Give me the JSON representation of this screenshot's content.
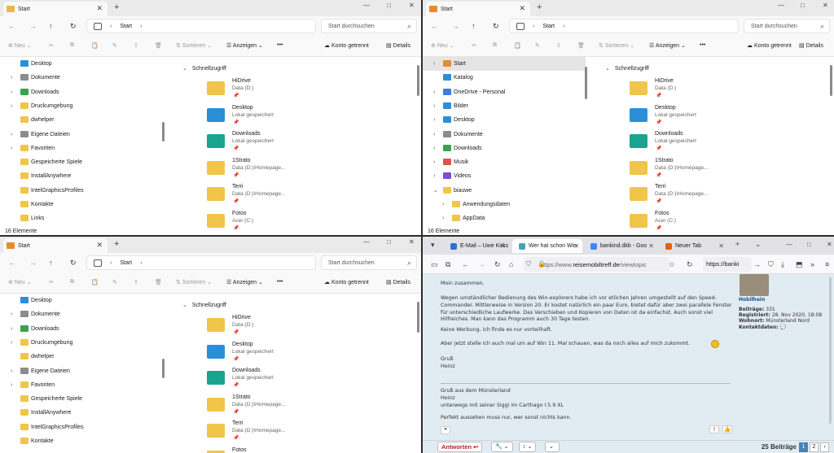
{
  "explorer": {
    "tab_title": "Start",
    "new_tab": "+",
    "minimize": "—",
    "maximize": "□",
    "close": "✕",
    "address": "Start",
    "search_placeholder": "Start durchsuchen",
    "toolbar": {
      "new": "Neu",
      "sort": "Sortieren",
      "view": "Anzeigen",
      "more": "•••",
      "account": "Konto getrennt",
      "details": "Details"
    },
    "sidebar_items": [
      {
        "label": "Desktop",
        "icon": "desktop-folder-icon",
        "color": "#2b8fd8",
        "chev": false
      },
      {
        "label": "Dokumente",
        "icon": "documents-folder-icon",
        "color": "#8c8c8c",
        "chev": true
      },
      {
        "label": "Downloads",
        "icon": "downloads-folder-icon",
        "color": "#3aa34a",
        "chev": true
      },
      {
        "label": "Druckumgebung",
        "icon": "folder-icon",
        "color": "#f0c54a",
        "chev": true
      },
      {
        "label": "dwhelper",
        "icon": "folder-icon",
        "color": "#f0c54a",
        "chev": false
      },
      {
        "label": "Eigene Dateien",
        "icon": "documents-folder-icon",
        "color": "#8c8c8c",
        "chev": true
      },
      {
        "label": "Favoriten",
        "icon": "star-folder-icon",
        "color": "#f0c54a",
        "chev": true
      },
      {
        "label": "Gespeicherte Spiele",
        "icon": "folder-icon",
        "color": "#f0c54a",
        "chev": false
      },
      {
        "label": "InstallAnywhere",
        "icon": "folder-icon",
        "color": "#f0c54a",
        "chev": false
      },
      {
        "label": "IntelGraphicsProfiles",
        "icon": "folder-icon",
        "color": "#f0c54a",
        "chev": false
      },
      {
        "label": "Kontakte",
        "icon": "folder-icon",
        "color": "#f0c54a",
        "chev": false
      },
      {
        "label": "Links",
        "icon": "folder-icon",
        "color": "#f0c54a",
        "chev": false
      }
    ],
    "sidebar_items_right": [
      {
        "label": "Start",
        "icon": "home-icon",
        "color": "#e98a2e",
        "chev": true,
        "selected": true
      },
      {
        "label": "Katalog",
        "icon": "gallery-icon",
        "color": "#2b8fd8",
        "chev": false
      },
      {
        "label": "OneDrive - Personal",
        "icon": "cloud-icon",
        "color": "#3b7de0",
        "chev": true
      },
      {
        "label": "Bilder",
        "icon": "pictures-folder-icon",
        "color": "#2b8fd8",
        "chev": true
      },
      {
        "label": "Desktop",
        "icon": "desktop-folder-icon",
        "color": "#2b8fd8",
        "chev": true
      },
      {
        "label": "Dokumente",
        "icon": "documents-folder-icon",
        "color": "#8c8c8c",
        "chev": true
      },
      {
        "label": "Downloads",
        "icon": "downloads-folder-icon",
        "color": "#3aa34a",
        "chev": true
      },
      {
        "label": "Musik",
        "icon": "music-folder-icon",
        "color": "#d9534f",
        "chev": true
      },
      {
        "label": "Videos",
        "icon": "videos-folder-icon",
        "color": "#7d4cd6",
        "chev": true
      },
      {
        "label": "biauwe",
        "icon": "folder-icon",
        "color": "#f0c54a",
        "chev": true,
        "open": true
      },
      {
        "label": "Anwendungsdaten",
        "icon": "folder-icon",
        "color": "#f0c54a",
        "chev": true,
        "indent": true
      },
      {
        "label": "AppData",
        "icon": "folder-icon",
        "color": "#f0c54a",
        "chev": true,
        "indent": true
      }
    ],
    "quick_access_header": "Schnellzugriff",
    "quick_access": [
      {
        "name": "HiDrive",
        "sub": "Data (D:)",
        "color": "#f0c54a"
      },
      {
        "name": "Desktop",
        "sub": "Lokal gespeichert",
        "color": "#2b8fd8"
      },
      {
        "name": "Downloads",
        "sub": "Lokal gespeichert",
        "color": "#1aa38e"
      },
      {
        "name": "1Strato",
        "sub": "Data (D:)\\Homepage...",
        "color": "#f0c54a"
      },
      {
        "name": "Terri",
        "sub": "Data (D:)\\Homepage...",
        "color": "#f0c54a"
      },
      {
        "name": "Fotos",
        "sub": "Acer (C:)",
        "color": "#f0c54a"
      }
    ],
    "status": "16 Elemente",
    "pin": "📌"
  },
  "browser": {
    "tabs": [
      {
        "title": "E-Mail – Uwe Kirks",
        "color": "#2f6fd1"
      },
      {
        "title": "Wer hat schon Win",
        "color": "#4a9fb5",
        "active": true
      },
      {
        "title": "bankind.dkb - Goo",
        "color": "#4285f4"
      },
      {
        "title": "Neuer Tab",
        "color": "#e66000"
      }
    ],
    "url_prefix": "https://www.",
    "url_domain": "reisemobiltreff.de",
    "url_rest": "/viewtopic",
    "url2": "https://banki",
    "post": {
      "greeting": "Moin zusammen,",
      "para1": "Wegen umständlicher Bedienung des Win-explorers habe ich vor etlichen Jahren umgestellt auf den Speed-Commander. Mittlerweise in Version 20. Er kostet natürlich ein paar Euro, bietet dafür aber zwei parallele Fenster für unterschiedliche Laufwerke. Das Verschieben und Kopieren von Daten ist da einfachst. Auch sonst viel Hilfreiches. Man kann das Programm auch 30 Tage testen.",
      "para2": "Keine Werbung, ich finde es nur vorteilhaft.",
      "para3": "Aber jetzt stelle ich auch mal um auf Win 11. Mal schauen, was da noch alles auf mich zukommt.",
      "closing1": "Gruß",
      "closing2": "Heinz",
      "sig1": "Gruß aus dem Münsterland",
      "sig2": "Heinz",
      "sig3": "unterwegs mit seiner Siggi im Carthago I 5.9 XL",
      "sig4": "Perfekt aussehen muss nur, wer sonst nichts kann."
    },
    "profile": {
      "username": "Hobilhein",
      "posts_label": "Beiträge:",
      "posts": "331",
      "registered_label": "Registriert:",
      "registered": "28. Nov 2020, 18:08",
      "location_label": "Wohnort:",
      "location": "Münsterland Nord",
      "contact_label": "Kontaktdaten:"
    },
    "reply": "Antworten",
    "page_count": "25 Beiträge",
    "pages": [
      "1",
      "2"
    ]
  }
}
